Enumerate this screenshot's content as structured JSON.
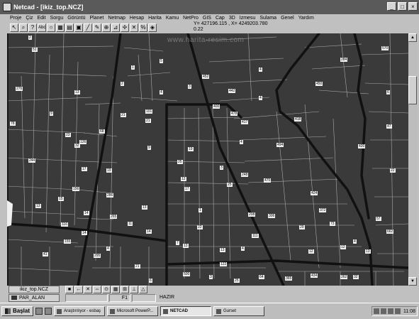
{
  "window": {
    "title": "Netcad - [ikiz_top.NCZ]",
    "buttons": [
      "_",
      "□",
      "×"
    ]
  },
  "menu": [
    "Proje",
    "Çiz",
    "Edit",
    "Sorgu",
    "Görüntü",
    "Planet",
    "Netmap",
    "Hesap",
    "Harita",
    "Kamu",
    "NetPro",
    "GIS",
    "Cap",
    "3D",
    "Izmesu",
    "Sulama",
    "Genel",
    "Yardım"
  ],
  "toolbar": {
    "tool_icons": [
      "pointer-icon",
      "magnify-icon",
      "help-icon",
      "text-abc-icon",
      "circle-icon",
      "grid-icon",
      "layer-icon",
      "select-icon",
      "line-icon",
      "pencil-icon",
      "zoom-icon",
      "measure-icon",
      "cursor-icon",
      "cross-icon",
      "percent-icon",
      "snap-icon"
    ],
    "abc_label": "Abc",
    "help_label": "?",
    "percent_label": "%"
  },
  "coordinates": {
    "line1": "Y= 427196.115 , X= 4249203.780",
    "line2": "0.22"
  },
  "watermark": "www.harita-resim.com",
  "parcels": [
    "2",
    "51",
    "1",
    "5",
    "4",
    "284",
    "570",
    "2",
    "276",
    "13",
    "452",
    "442",
    "3",
    "450",
    "4",
    "4",
    "6",
    "400",
    "9",
    "101",
    "21",
    "418",
    "478",
    "417",
    "21",
    "47",
    "78",
    "68",
    "494",
    "23",
    "420",
    "4",
    "32",
    "9",
    "19",
    "126",
    "244",
    "17",
    "25",
    "3",
    "248",
    "470",
    "22",
    "19",
    "12",
    "25",
    "156",
    "17",
    "286",
    "424",
    "13",
    "15",
    "13",
    "208",
    "372",
    "14",
    "1",
    "265",
    "116",
    "11",
    "306",
    "14",
    "57",
    "29",
    "14",
    "13",
    "4",
    "22",
    "155",
    "13",
    "111",
    "73",
    "662",
    "4",
    "295",
    "7",
    "21",
    "12",
    "12",
    "13",
    "4",
    "41",
    "122",
    "500",
    "434",
    "262",
    "32",
    "3",
    "64",
    "365",
    "6",
    "25"
  ],
  "status": {
    "layer_file": "ikiz_top.NCZ",
    "layer_name": "PAR_ALAN",
    "field1": "",
    "field2": "F1",
    "field3": "",
    "state": "HAZIR"
  },
  "taskbar": {
    "start_label": "Başlat",
    "tasks": [
      "Araştırılıyor - esbaş",
      "Microsoft PowerP...",
      "NETCAD",
      "Gurset"
    ],
    "active_index": 2,
    "clock": "11:08"
  }
}
